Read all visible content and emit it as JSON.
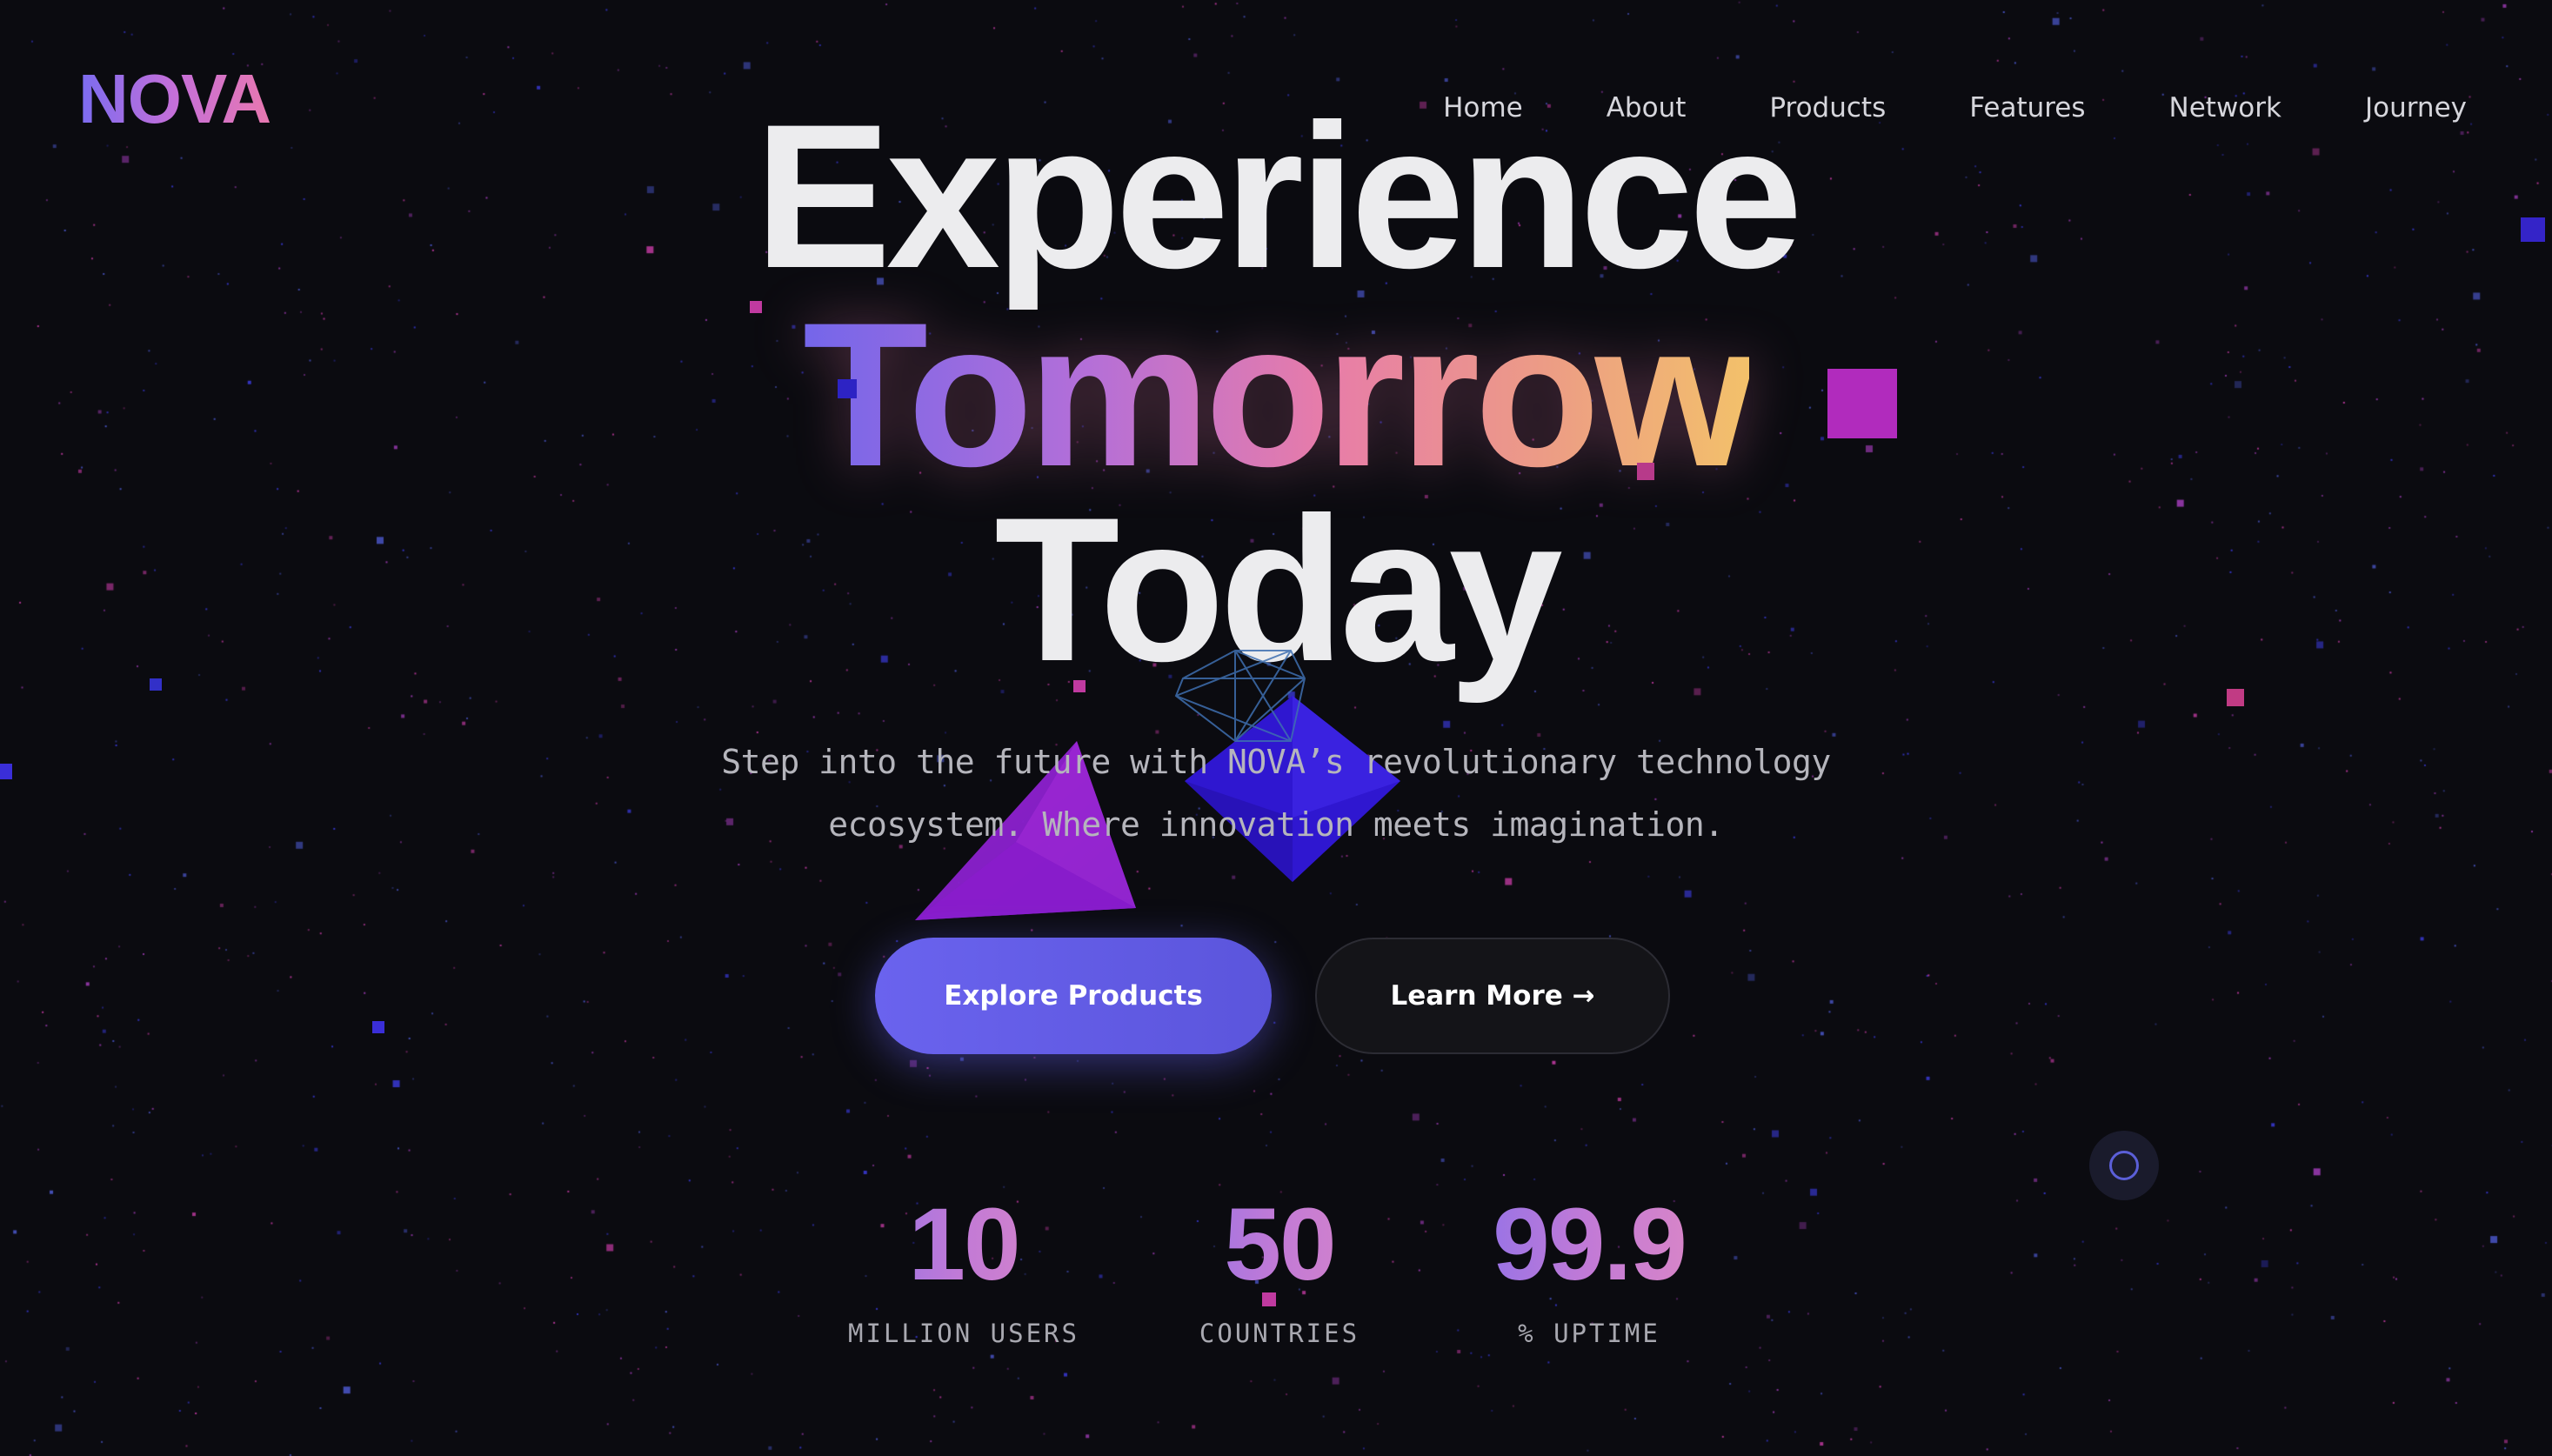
{
  "brand": {
    "logo": "NOVA"
  },
  "nav": {
    "items": [
      {
        "label": "Home"
      },
      {
        "label": "About"
      },
      {
        "label": "Products"
      },
      {
        "label": "Features"
      },
      {
        "label": "Network"
      },
      {
        "label": "Journey"
      }
    ]
  },
  "hero": {
    "line1": "Experience",
    "line2": "Tomorrow",
    "line3": "Today",
    "subtitle_line1": "Step into the future with NOVA’s revolutionary technology",
    "subtitle_line2": "ecosystem. Where innovation meets imagination.",
    "primary_cta": "Explore Products",
    "secondary_cta": "Learn More →"
  },
  "stats": [
    {
      "value": "10",
      "label": "MILLION USERS"
    },
    {
      "value": "50",
      "label": "COUNTRIES"
    },
    {
      "value": "99.9",
      "label": "% UPTIME"
    }
  ],
  "colors": {
    "background": "#0b0b10",
    "accent_indigo": "#6a63ee",
    "accent_pink": "#e77ca9",
    "accent_gold": "#f3c16a",
    "particle_blue": "#3a3ad8",
    "particle_magenta": "#c03aa0"
  },
  "icons": {
    "wireframe": "geodesic-sphere-icon",
    "loader": "loading-ring-icon"
  }
}
